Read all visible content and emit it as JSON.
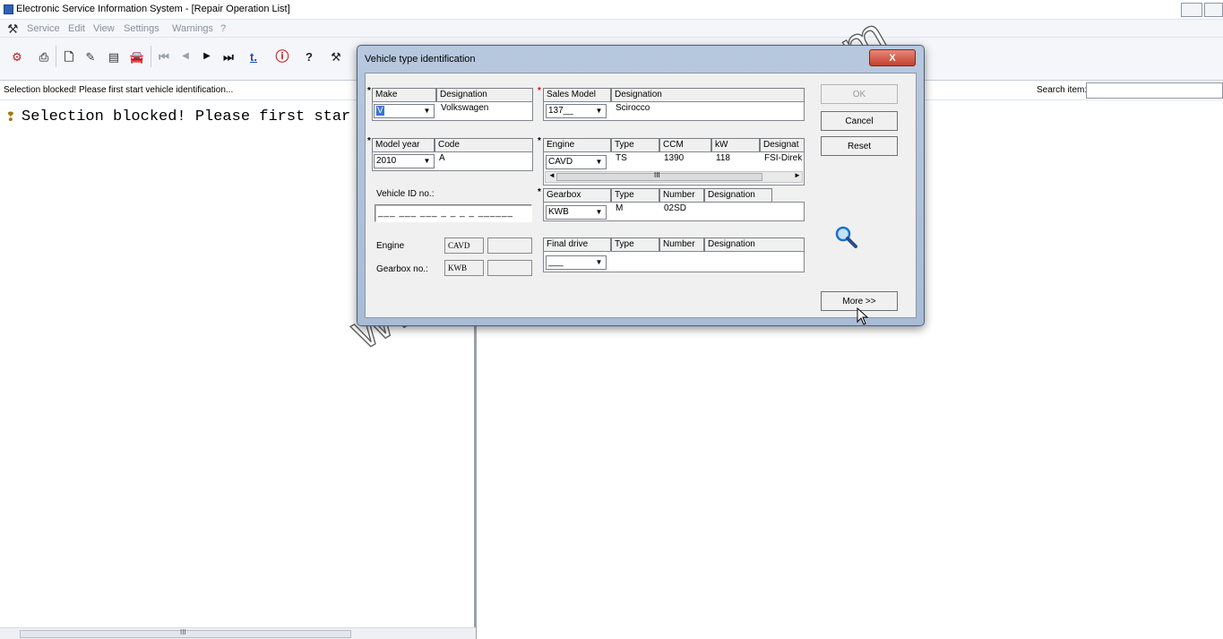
{
  "window": {
    "title": "Electronic Service Information System - [Repair Operation List]",
    "menu": [
      "Service",
      "Edit",
      "View",
      "Settings",
      "Warnings",
      "?"
    ]
  },
  "toolbar": {
    "buttons": [
      {
        "icon": "app-icon",
        "glyph": "⚙",
        "color": "#b21f1f"
      },
      {
        "icon": "print-icon",
        "glyph": "⎙",
        "color": "#666666"
      },
      {
        "icon": "new-document-icon",
        "glyph": "🗋",
        "color": "#333333"
      },
      {
        "icon": "edit-document-icon",
        "glyph": "✎",
        "color": "#333333"
      },
      {
        "icon": "vehicle-document-icon",
        "glyph": "▤",
        "color": "#333333"
      },
      {
        "icon": "car-icon",
        "glyph": "🚘",
        "color": "#444444"
      },
      {
        "icon": "first-record-icon",
        "glyph": "⏮",
        "color": "#9aa0a8"
      },
      {
        "icon": "previous-record-icon",
        "glyph": "◀",
        "color": "#9aa0a8"
      },
      {
        "icon": "next-record-icon",
        "glyph": "▶",
        "color": "#111111"
      },
      {
        "icon": "last-record-icon",
        "glyph": "⏭",
        "color": "#111111"
      },
      {
        "icon": "time-icon",
        "glyph": "t.",
        "color": "#1b4fb0"
      },
      {
        "icon": "info-icon",
        "glyph": "ⓘ",
        "color": "#cc1a1a"
      },
      {
        "icon": "help-icon",
        "glyph": "?",
        "color": "#222222"
      },
      {
        "icon": "tools-icon",
        "glyph": "⚒",
        "color": "#222222"
      }
    ]
  },
  "status": {
    "message": "Selection blocked! Please first start vehicle identification...",
    "search_label": "Search item:",
    "search_value": ""
  },
  "left_pane": {
    "message": "Selection blocked! Please first star",
    "scroll_marker": "III"
  },
  "watermark": "www.autoepccatalog.com",
  "dialog": {
    "title": "Vehicle type identification",
    "close_label": "X",
    "make": {
      "header": "Make",
      "designation_header": "Designation",
      "value": "V",
      "designation": "Volkswagen"
    },
    "sales_model": {
      "header": "Sales Model",
      "designation_header": "Designation",
      "value": "137__",
      "designation": "Scirocco"
    },
    "model_year": {
      "header": "Model year",
      "code_header": "Code",
      "value": "2010",
      "code": "A"
    },
    "engine": {
      "header": "Engine",
      "type_header": "Type",
      "ccm_header": "CCM",
      "kw_header": "kW",
      "designation_header": "Designat",
      "value": "CAVD",
      "type": "TS",
      "ccm": "1390",
      "kw": "118",
      "designation": "FSI-Direk",
      "scroll_marker": "III"
    },
    "gearbox": {
      "header": "Gearbox",
      "type_header": "Type",
      "number_header": "Number",
      "designation_header": "Designation",
      "value": "KWB",
      "type": "M",
      "number": "02SD",
      "designation": ""
    },
    "final_drive": {
      "header": "Final drive",
      "type_header": "Type",
      "number_header": "Number",
      "designation_header": "Designation",
      "value": "___"
    },
    "vehicle_id": {
      "label": "Vehicle ID no.:",
      "placeholder": "___ ___ ___ _ _ _ _ ______"
    },
    "engine_code": {
      "label": "Engine",
      "value": "CAVD",
      "extra": ""
    },
    "gearbox_no": {
      "label": "Gearbox no.:",
      "value": "KWB",
      "extra": ""
    },
    "buttons": {
      "ok": "OK",
      "cancel": "Cancel",
      "reset": "Reset",
      "more": "More >>"
    }
  },
  "colors": {
    "required_marker": "#d01010",
    "accent": "#2e62b5",
    "close_button": "#c4412e"
  }
}
